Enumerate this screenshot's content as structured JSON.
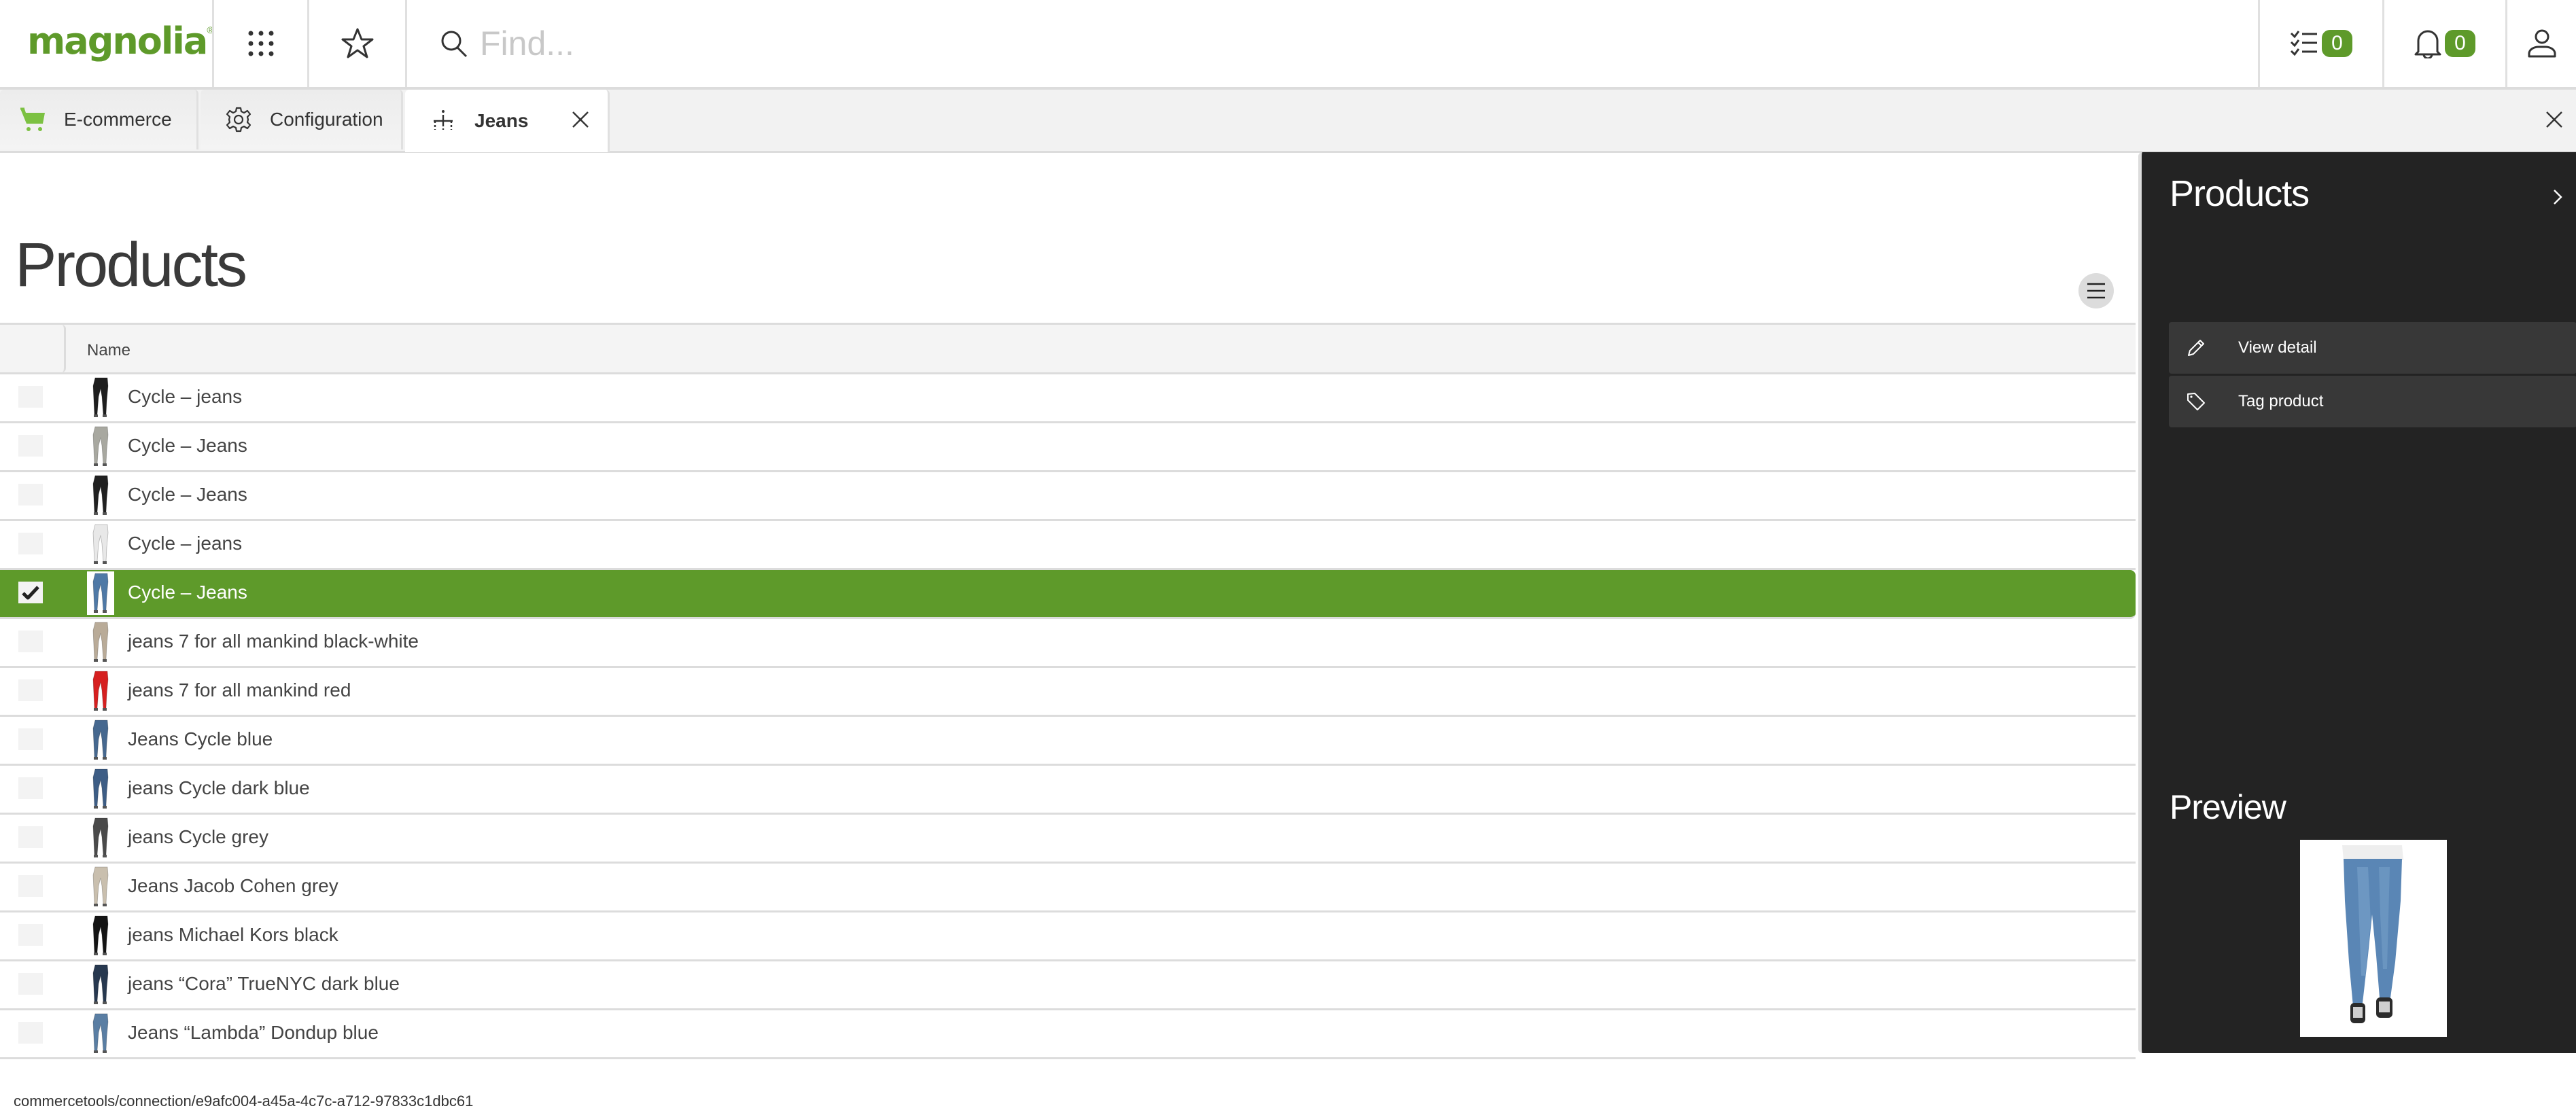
{
  "header": {
    "logo_text": "magnolia",
    "logo_mark": "®",
    "apps_icon": "apps-grid-icon",
    "favorites_icon": "star-icon",
    "search_icon": "search-icon",
    "search_placeholder": "Find...",
    "search_value": "",
    "tasks_icon": "tasks-checklist-icon",
    "tasks_count": "0",
    "notifications_icon": "bell-icon",
    "notifications_count": "0",
    "user_icon": "user-icon",
    "accent_color": "#5e9a2a"
  },
  "tabs": [
    {
      "label": "E-commerce",
      "icon": "cart-icon",
      "active": false
    },
    {
      "label": "Configuration",
      "icon": "gear-icon",
      "active": false
    },
    {
      "label": "Jeans",
      "icon": "hierarchy-icon",
      "active": true,
      "closable": true
    }
  ],
  "main": {
    "title": "Products",
    "column_menu_icon": "menu-icon",
    "columns": [
      "Name"
    ],
    "rows": [
      {
        "name": "Cycle – jeans",
        "selected": false,
        "thumb_color": "#1e1e1e"
      },
      {
        "name": "Cycle – Jeans",
        "selected": false,
        "thumb_color": "#a8a8a0"
      },
      {
        "name": "Cycle – Jeans",
        "selected": false,
        "thumb_color": "#202020"
      },
      {
        "name": "Cycle – jeans",
        "selected": false,
        "thumb_color": "#e8e8e8"
      },
      {
        "name": "Cycle – Jeans",
        "selected": true,
        "thumb_color": "#4f79a6"
      },
      {
        "name": "jeans 7 for all mankind black-white",
        "selected": false,
        "thumb_color": "#b9ab98"
      },
      {
        "name": "jeans 7 for all mankind red",
        "selected": false,
        "thumb_color": "#d62020"
      },
      {
        "name": "Jeans Cycle blue",
        "selected": false,
        "thumb_color": "#46688f"
      },
      {
        "name": "jeans Cycle dark blue",
        "selected": false,
        "thumb_color": "#3d5d85"
      },
      {
        "name": "jeans Cycle grey",
        "selected": false,
        "thumb_color": "#4a4a4a"
      },
      {
        "name": "Jeans Jacob Cohen grey",
        "selected": false,
        "thumb_color": "#c9bfae"
      },
      {
        "name": "jeans Michael Kors black",
        "selected": false,
        "thumb_color": "#141414"
      },
      {
        "name": "jeans “Cora” TrueNYC dark blue",
        "selected": false,
        "thumb_color": "#27384f"
      },
      {
        "name": "Jeans “Lambda” Dondup blue",
        "selected": false,
        "thumb_color": "#5a7ea3"
      }
    ],
    "footer_path": "commercetools/connection/e9afc004-a45a-4c7c-a712-97833c1dbc61"
  },
  "right_panel": {
    "title": "Products",
    "collapse_icon": "chevron-right-icon",
    "actions": [
      {
        "label": "View detail",
        "icon": "pencil-icon"
      },
      {
        "label": "Tag product",
        "icon": "tag-icon"
      }
    ],
    "preview_title": "Preview",
    "preview_subject": "blue jeans"
  }
}
